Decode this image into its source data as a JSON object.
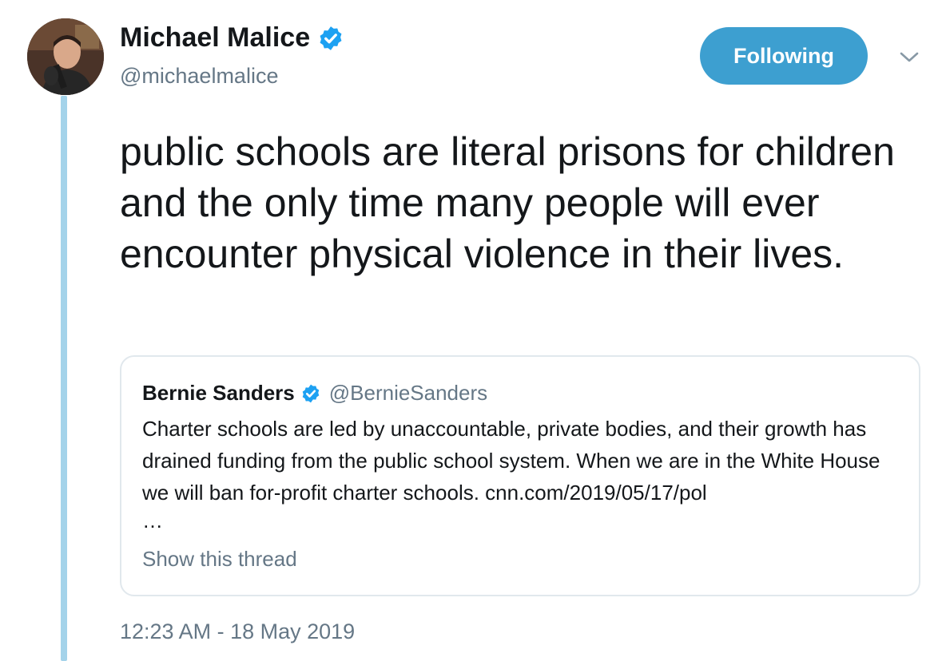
{
  "author": {
    "display_name": "Michael Malice",
    "handle": "@michaelmalice",
    "avatar_icon": "profile-photo",
    "verified_icon": "verified-badge-icon"
  },
  "follow_button": {
    "label": "Following"
  },
  "menu_icon": "chevron-down-icon",
  "tweet": {
    "text": "public schools are literal prisons for children and the only time many people will ever encounter physical violence in their lives."
  },
  "quoted_tweet": {
    "display_name": "Bernie Sanders",
    "handle": "@BernieSanders",
    "text": "Charter schools are led by unaccountable, private bodies, and their growth has drained funding from the public school system. When we are in the White House we will ban for-profit charter schools. cnn.com/2019/05/17/pol",
    "ellipsis": "…",
    "show_thread": "Show this thread"
  },
  "timestamp": "12:23 AM - 18 May 2019",
  "colors": {
    "accent": "#3d9fd0",
    "thread_line": "#a4d3ea",
    "secondary_text": "#657786",
    "card_border": "#e1e8ed"
  }
}
